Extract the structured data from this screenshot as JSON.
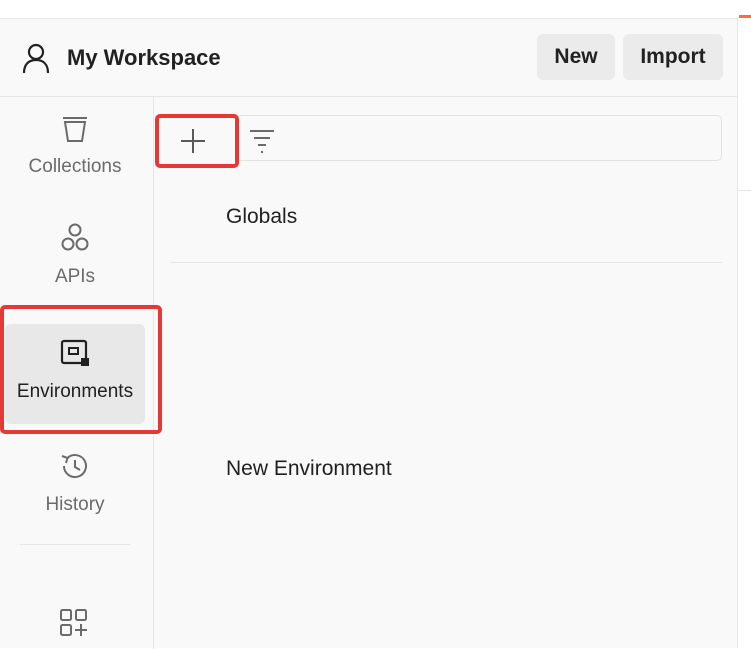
{
  "header": {
    "workspace_title": "My Workspace",
    "new_label": "New",
    "import_label": "Import"
  },
  "sidebar": {
    "items": [
      {
        "label": "Collections",
        "icon": "collections-icon"
      },
      {
        "label": "APIs",
        "icon": "apis-icon"
      },
      {
        "label": "Environments",
        "icon": "environments-icon",
        "active": true
      },
      {
        "label": "History",
        "icon": "history-icon"
      }
    ],
    "more_icon": "add-apps-icon"
  },
  "environments": {
    "rows": [
      "Globals",
      "New Environment"
    ]
  },
  "colors": {
    "accent": "#ff6c37",
    "highlight": "#e53935",
    "panel_bg": "#f9f9f9",
    "active_bg": "#e8e8e8"
  }
}
